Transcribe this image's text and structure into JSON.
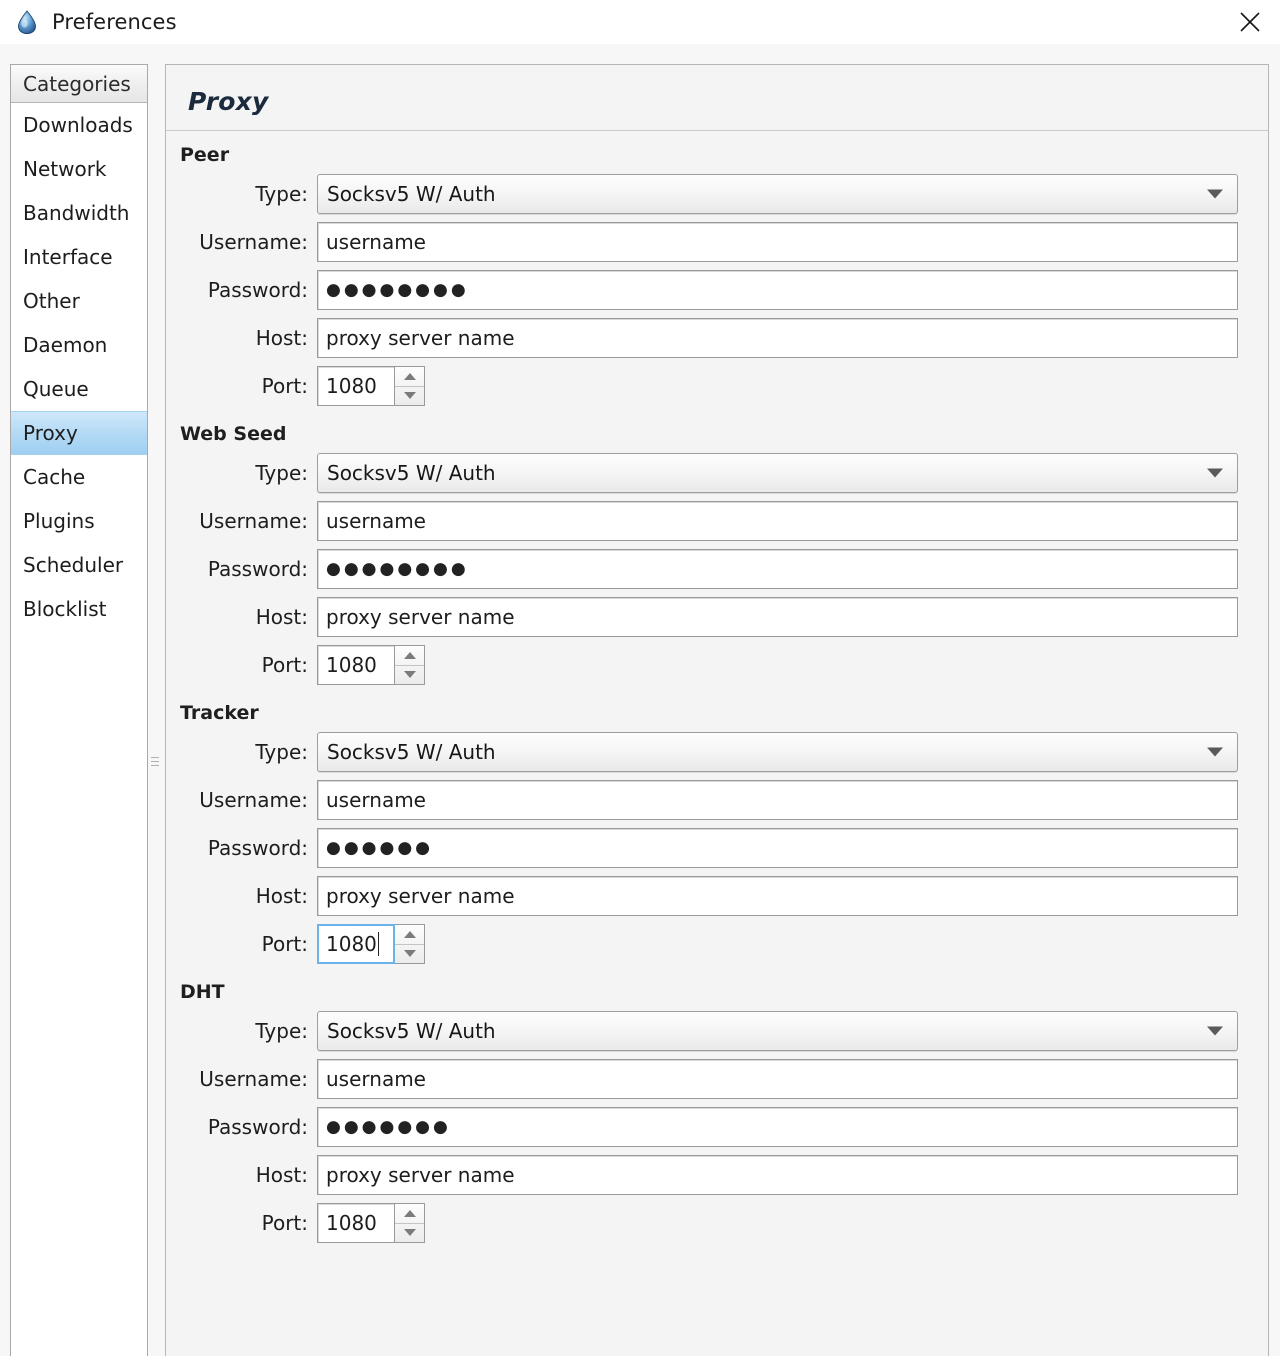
{
  "window": {
    "title": "Preferences",
    "app_icon": "deluge-waterdrop-icon",
    "close_icon": "close-icon"
  },
  "sidebar": {
    "header": "Categories",
    "items": [
      {
        "label": "Downloads",
        "selected": false
      },
      {
        "label": "Network",
        "selected": false
      },
      {
        "label": "Bandwidth",
        "selected": false
      },
      {
        "label": "Interface",
        "selected": false
      },
      {
        "label": "Other",
        "selected": false
      },
      {
        "label": "Daemon",
        "selected": false
      },
      {
        "label": "Queue",
        "selected": false
      },
      {
        "label": "Proxy",
        "selected": true
      },
      {
        "label": "Cache",
        "selected": false
      },
      {
        "label": "Plugins",
        "selected": false
      },
      {
        "label": "Scheduler",
        "selected": false
      },
      {
        "label": "Blocklist",
        "selected": false
      }
    ],
    "selected_bg": "#b4daf5"
  },
  "panel": {
    "title": "Proxy",
    "labels": {
      "type": "Type:",
      "username": "Username:",
      "password": "Password:",
      "host": "Host:",
      "port": "Port:"
    },
    "sections": [
      {
        "heading": "Peer",
        "type_value": "Socksv5 W/ Auth",
        "username_value": "username",
        "password_dots": "●●●●●●●●",
        "host_value": "proxy server name",
        "port_value": "1080",
        "port_focused": false
      },
      {
        "heading": "Web Seed",
        "type_value": "Socksv5 W/ Auth",
        "username_value": "username",
        "password_dots": "●●●●●●●●",
        "host_value": "proxy server name",
        "port_value": "1080",
        "port_focused": false
      },
      {
        "heading": "Tracker",
        "type_value": "Socksv5 W/ Auth",
        "username_value": "username",
        "password_dots": "●●●●●●",
        "host_value": "proxy server name",
        "port_value": "1080",
        "port_focused": true
      },
      {
        "heading": "DHT",
        "type_value": "Socksv5 W/ Auth",
        "username_value": "username",
        "password_dots": "●●●●●●●",
        "host_value": "proxy server name",
        "port_value": "1080",
        "port_focused": false
      }
    ]
  }
}
